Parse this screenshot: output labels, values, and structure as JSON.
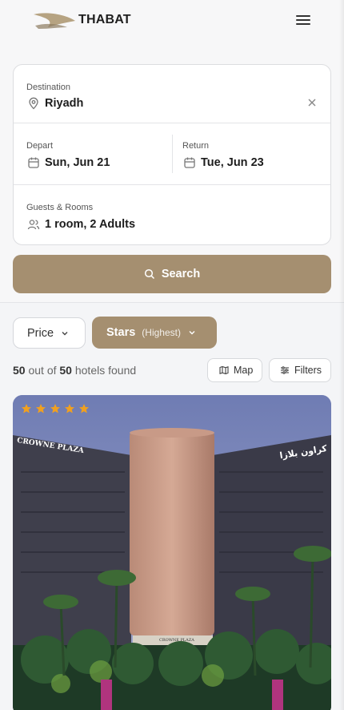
{
  "brand": {
    "name": "THABAT"
  },
  "search": {
    "destination_label": "Destination",
    "destination_value": "Riyadh",
    "depart_label": "Depart",
    "depart_value": "Sun, Jun 21",
    "return_label": "Return",
    "return_value": "Tue, Jun 23",
    "guests_label": "Guests & Rooms",
    "guests_value": "1 room, 2 Adults",
    "search_button": "Search"
  },
  "sort": {
    "price_label": "Price",
    "stars_label": "Stars",
    "stars_sub": "(Highest)"
  },
  "results": {
    "shown": "50",
    "out_of_text": "out of",
    "total": "50",
    "suffix": "hotels found"
  },
  "actions": {
    "map_label": "Map",
    "filters_label": "Filters"
  },
  "hotel": {
    "stars": 5,
    "sign_left": "CROWNE PLAZA",
    "sign_right": "كراون بلازا",
    "entrance_sign": "CROWNE PLAZA"
  },
  "colors": {
    "accent": "#a58f70",
    "star": "#f0a020",
    "sky": "#7d8ab5"
  },
  "icons": [
    "menu-icon",
    "map-pin-icon",
    "close-icon",
    "calendar-icon",
    "users-icon",
    "search-icon",
    "chevron-down-icon",
    "map-icon",
    "filters-icon",
    "star-icon"
  ]
}
